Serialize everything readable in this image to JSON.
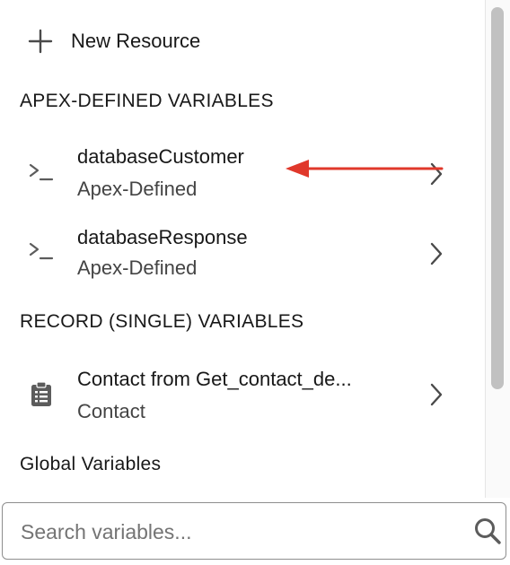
{
  "new_resource": {
    "label": "New Resource",
    "icon": "plus-icon"
  },
  "sections": {
    "apex": {
      "header": "APEX-DEFINED VARIABLES"
    },
    "record": {
      "header": "RECORD (SINGLE) VARIABLES"
    },
    "global": {
      "header": "Global Variables"
    }
  },
  "items": [
    {
      "name": "databaseCustomer",
      "type": "Apex-Defined",
      "icon": "apex-variable-icon"
    },
    {
      "name": "databaseResponse",
      "type": "Apex-Defined",
      "icon": "apex-variable-icon"
    },
    {
      "name": "Contact from Get_contact_de...",
      "type": "Contact",
      "icon": "record-icon"
    }
  ],
  "search": {
    "placeholder": "Search variables...",
    "value": "",
    "icon": "search-icon"
  },
  "colors": {
    "annotation_arrow": "#e0382b",
    "scrollbar_thumb": "#c1c1c1",
    "icon_gray": "#5c5c5c"
  }
}
